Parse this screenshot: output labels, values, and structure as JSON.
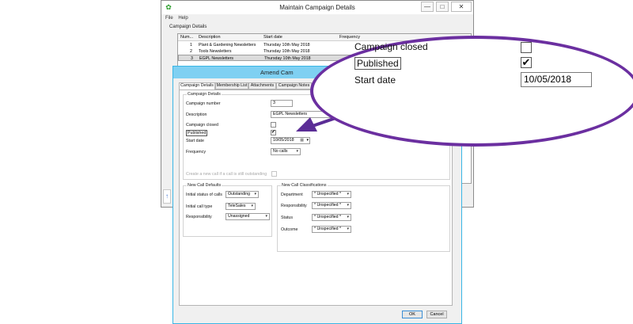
{
  "back_window": {
    "title": "Maintain Campaign Details",
    "menu": [
      "File",
      "Help"
    ],
    "section_label": "Campaign Details",
    "controls": {
      "minimize": "—",
      "maximize": "□",
      "close": "✕"
    },
    "table": {
      "columns": [
        "Num...",
        "Description",
        "Start date",
        "Frequency"
      ],
      "rows": [
        {
          "num": "1",
          "description": "Plant & Gardening Newsletters",
          "start_date": "Thursday 10th May 2018"
        },
        {
          "num": "2",
          "description": "Tools Newsletters",
          "start_date": "Thursday 10th May 2018"
        },
        {
          "num": "3",
          "description": "EGPL Newsletters",
          "start_date": "Thursday 10th May 2018"
        }
      ]
    }
  },
  "dialog": {
    "title": "Amend Cam",
    "tabs": [
      "Campaign Details",
      "Membership List",
      "Attachments",
      "Campaign Notes"
    ],
    "details_group": "Campaign Details",
    "fields": {
      "campaign_number_label": "Campaign number",
      "campaign_number": "3",
      "description_label": "Description",
      "description": "EGPL Newsletters",
      "campaign_closed_label": "Campaign closed",
      "campaign_closed": "",
      "published_label": "Published",
      "published": "✔",
      "start_date_label": "Start date",
      "start_date": "10/05/2018",
      "frequency_label": "Frequency",
      "frequency": "No calls",
      "create_call_label": "Create a new call if a call is still outstanding"
    },
    "defaults_group": "New Call Defaults",
    "defaults": {
      "initial_status_label": "Initial status of calls",
      "initial_status": "Outstanding",
      "initial_type_label": "Initial call type",
      "initial_type": "TeleSales",
      "responsibility_label": "Responsibility",
      "responsibility": "Unassigned"
    },
    "classifications_group": "New Call Classifications",
    "classifications": {
      "department_label": "Department",
      "department": "* Unspecified *",
      "responsibility_label": "Responsibility",
      "responsibility": "* Unspecified *",
      "status_label": "Status",
      "status": "* Unspecified *",
      "outcome_label": "Outcome",
      "outcome": "* Unspecified *"
    },
    "ok": "OK",
    "cancel": "Cancel"
  },
  "callout": {
    "campaign_closed_label": "Campaign closed",
    "published_label": "Published",
    "published": "✔",
    "start_date_label": "Start date",
    "start_date": "10/05/2018"
  },
  "colors": {
    "callout_border": "#6b2fa0",
    "arrow": "#5b2d96",
    "dialog_title": "#7fd0f2"
  },
  "icons": {
    "app": "green-gear-icon",
    "checkmark": "check-icon",
    "dropdown": "chevron-down-icon",
    "calendar": "calendar-icon"
  }
}
